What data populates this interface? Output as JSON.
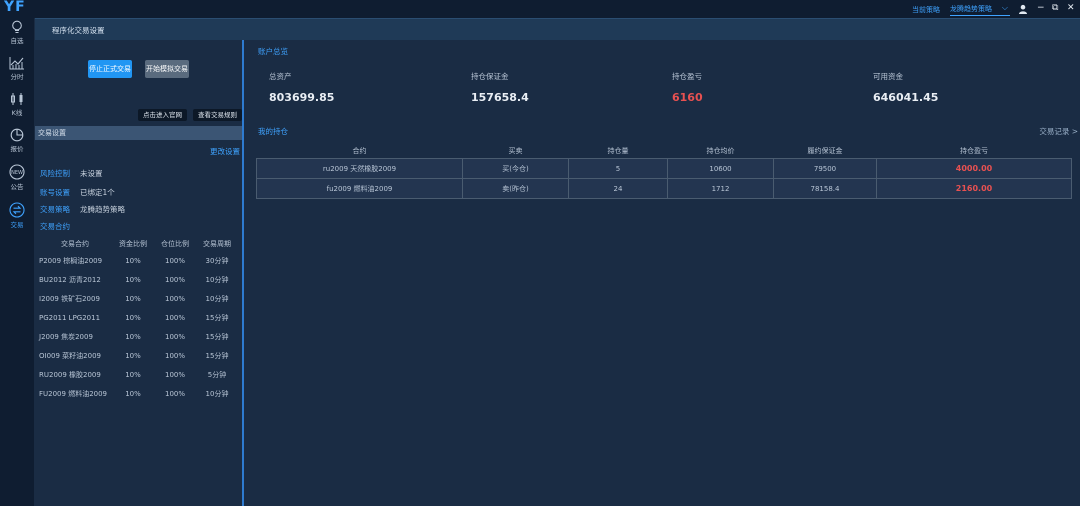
{
  "app": {
    "logo": "YF"
  },
  "topbar": {
    "strategy_label": "当前策略",
    "strategy_value": "龙腾趋势策略",
    "controls": {
      "minimize": "−",
      "restore": "⧉",
      "close": "✕"
    }
  },
  "nav": {
    "items": [
      {
        "label": "自选",
        "icon": "lightbulb-icon"
      },
      {
        "label": "分时",
        "icon": "line-chart-icon"
      },
      {
        "label": "K线",
        "icon": "candlestick-icon"
      },
      {
        "label": "报价",
        "icon": "pie-chart-icon"
      },
      {
        "label": "公告",
        "icon": "new-badge-icon",
        "badge": "NEW"
      },
      {
        "label": "交易",
        "icon": "exchange-icon",
        "active": true
      }
    ]
  },
  "tab": {
    "title": "程序化交易设置"
  },
  "controls": {
    "stop_live": "停止正式交易",
    "start_sim": "开始模拟交易",
    "enter_site": "点击进入官网",
    "view_rules": "查看交易规则"
  },
  "settings": {
    "header": "交易设置",
    "edit_link": "更改设置",
    "risk_label": "风险控制",
    "risk_value": "未设置",
    "account_label": "账号设置",
    "account_value": "已绑定1个",
    "strategy_label": "交易策略",
    "strategy_value": "龙腾趋势策略",
    "contracts_title": "交易合约",
    "contracts_headers": [
      "交易合约",
      "资金比例",
      "仓位比例",
      "交易周期"
    ],
    "contracts": [
      [
        "P2009  棕榈油2009",
        "10%",
        "100%",
        "30分钟"
      ],
      [
        "BU2012  沥青2012",
        "10%",
        "100%",
        "10分钟"
      ],
      [
        "I2009  铁矿石2009",
        "10%",
        "100%",
        "10分钟"
      ],
      [
        "PG2011  LPG2011",
        "10%",
        "100%",
        "15分钟"
      ],
      [
        "J2009  焦炭2009",
        "10%",
        "100%",
        "15分钟"
      ],
      [
        "OI009  菜籽油2009",
        "10%",
        "100%",
        "15分钟"
      ],
      [
        "RU2009  橡胶2009",
        "10%",
        "100%",
        "5分钟"
      ],
      [
        "FU2009  燃料油2009",
        "10%",
        "100%",
        "10分钟"
      ]
    ]
  },
  "overview": {
    "title": "账户总览",
    "stats": [
      {
        "label": "总资产",
        "value": "803699.85"
      },
      {
        "label": "持仓保证金",
        "value": "157658.4"
      },
      {
        "label": "持仓盈亏",
        "value": "6160"
      },
      {
        "label": "可用资金",
        "value": "646041.45"
      }
    ],
    "colors": {
      "loss_profit": "#e85151",
      "accent": "#3fa3ff"
    }
  },
  "positions": {
    "title": "我的持仓",
    "records_link": "交易记录 >",
    "headers": [
      "合约",
      "买卖",
      "持仓量",
      "持仓均价",
      "履约保证金",
      "持仓盈亏"
    ],
    "rows": [
      [
        "ru2009 天然橡胶2009",
        "买(今仓)",
        "5",
        "10600",
        "79500",
        "4000.00"
      ],
      [
        "fu2009 燃料油2009",
        "卖(昨仓)",
        "24",
        "1712",
        "78158.4",
        "2160.00"
      ]
    ]
  }
}
